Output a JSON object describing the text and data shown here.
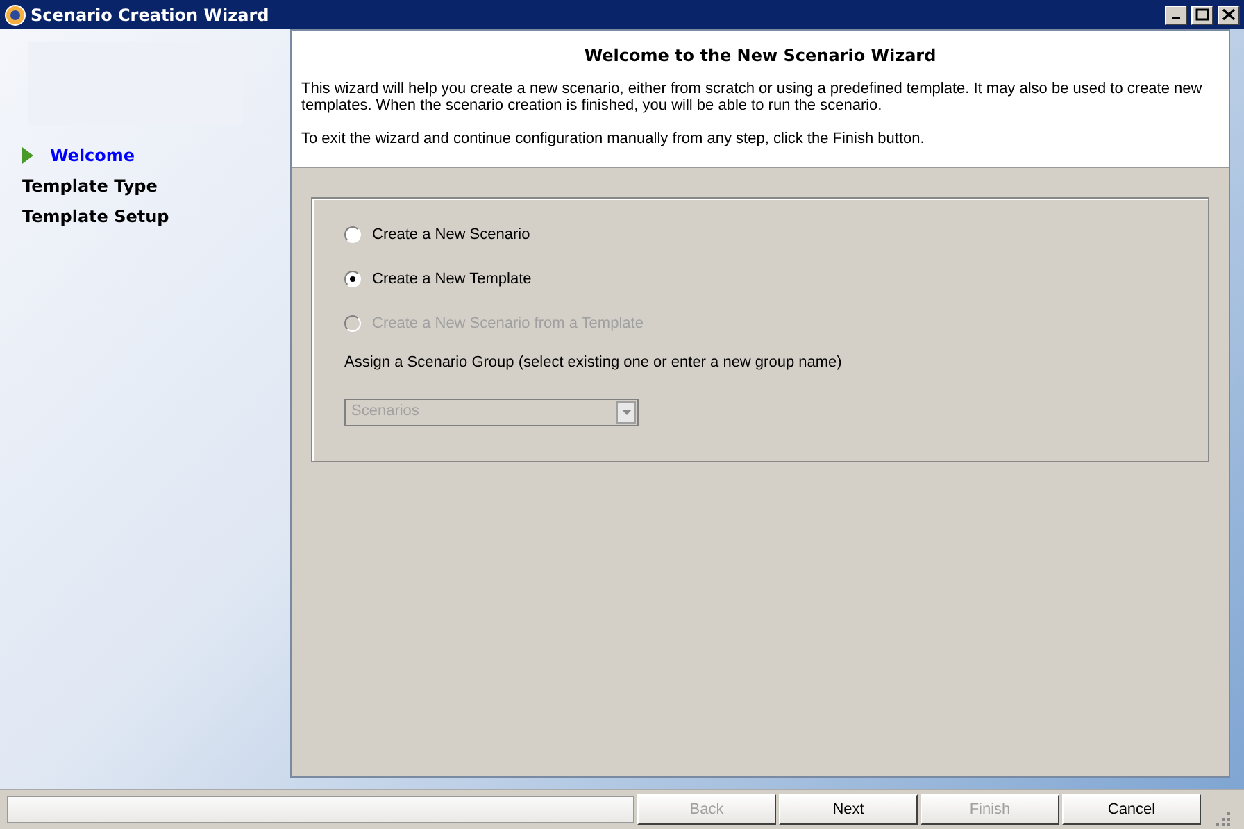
{
  "window": {
    "title": "Scenario Creation Wizard"
  },
  "steps": [
    {
      "label": "Welcome",
      "selected": true
    },
    {
      "label": "Template Type",
      "selected": false
    },
    {
      "label": "Template Setup",
      "selected": false
    }
  ],
  "header": {
    "title": "Welcome to the New Scenario Wizard",
    "paragraphs": [
      "This wizard will help you create a new scenario, either from scratch or using a predefined template. It may also be used to create new templates. When the scenario creation is finished, you will be able to run the scenario.",
      "To exit the wizard and continue configuration manually from any step, click the Finish button."
    ]
  },
  "options": [
    {
      "label": "Create a New Scenario",
      "selected": false,
      "disabled": false
    },
    {
      "label": "Create a New Template",
      "selected": true,
      "disabled": false
    },
    {
      "label": "Create a New Scenario from a Template",
      "selected": false,
      "disabled": true
    }
  ],
  "group": {
    "label": "Assign a Scenario Group (select existing one or enter a new group name)",
    "value": "Scenarios",
    "disabled": true
  },
  "buttons": [
    {
      "label": "Back",
      "disabled": true
    },
    {
      "label": "Next",
      "disabled": false
    },
    {
      "label": "Finish",
      "disabled": true
    },
    {
      "label": "Cancel",
      "disabled": false
    }
  ]
}
